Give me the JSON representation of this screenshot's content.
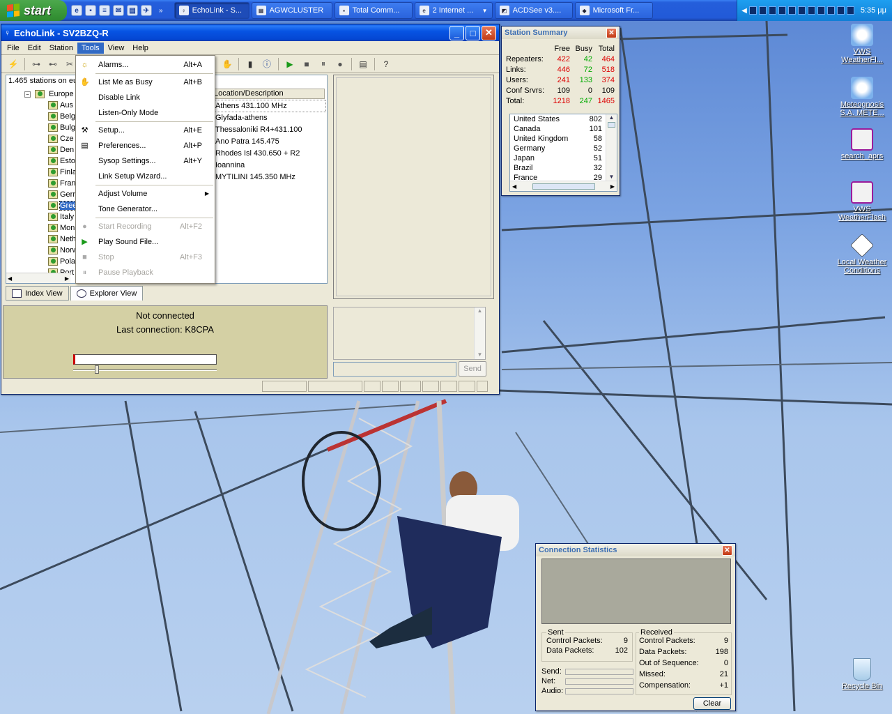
{
  "taskbar": {
    "start_label": "start",
    "tasks": [
      {
        "label": "EchoLink - S..."
      },
      {
        "label": "AGWCLUSTER"
      },
      {
        "label": "Total Comm..."
      },
      {
        "label": "2 Internet ..."
      },
      {
        "label": "ACDSee v3...."
      },
      {
        "label": "Microsoft Fr..."
      }
    ],
    "clock": "5:35 μμ"
  },
  "echolink": {
    "title": "EchoLink - SV2BZQ-R",
    "menu": [
      "File",
      "Edit",
      "Station",
      "Tools",
      "View",
      "Help"
    ],
    "tree_header": "1.465 stations on eu",
    "tree_root": "Europe",
    "tree_items": [
      "Aus",
      "Belg",
      "Bulg",
      "Cze",
      "Den",
      "Esto",
      "Finla",
      "Fran",
      "Gerr",
      "Gree",
      "Italy",
      "Mon",
      "Neth",
      "Norw",
      "Pola",
      "Port"
    ],
    "column_header": "Location/Description",
    "rows": [
      "Athens 431.100 MHz",
      "Glyfada-athens",
      "Thessaloniki R4+431.100",
      "Ano Patra 145.475",
      "Rhodes Isl 430.650 + R2",
      "Ioannina",
      "MYTILINI 145.350 MHz"
    ],
    "tabs": {
      "index": "Index View",
      "explorer": "Explorer View"
    },
    "status_line1": "Not connected",
    "status_line2": "Last connection: K8CPA",
    "send_label": "Send"
  },
  "tools_menu": {
    "items": [
      {
        "label": "Alarms...",
        "shortcut": "Alt+A",
        "icon": "alarm-icon",
        "enabled": true
      },
      {
        "label": "List Me as Busy",
        "shortcut": "Alt+B",
        "icon": "hand-icon",
        "enabled": true
      },
      {
        "label": "Disable Link",
        "shortcut": "",
        "icon": "",
        "enabled": true
      },
      {
        "label": "Listen-Only Mode",
        "shortcut": "",
        "icon": "",
        "enabled": true
      },
      {
        "label": "Setup...",
        "shortcut": "Alt+E",
        "icon": "tools-icon",
        "enabled": true
      },
      {
        "label": "Preferences...",
        "shortcut": "Alt+P",
        "icon": "preferences-icon",
        "enabled": true
      },
      {
        "label": "Sysop Settings...",
        "shortcut": "Alt+Y",
        "icon": "",
        "enabled": true
      },
      {
        "label": "Link Setup Wizard...",
        "shortcut": "",
        "icon": "",
        "enabled": true
      },
      {
        "label": "Adjust Volume",
        "shortcut": "",
        "icon": "",
        "enabled": true
      },
      {
        "label": "Tone Generator...",
        "shortcut": "",
        "icon": "",
        "enabled": true
      },
      {
        "label": "Start Recording",
        "shortcut": "Alt+F2",
        "icon": "record-icon",
        "enabled": false
      },
      {
        "label": "Play Sound File...",
        "shortcut": "",
        "icon": "play-icon",
        "enabled": true
      },
      {
        "label": "Stop",
        "shortcut": "Alt+F3",
        "icon": "stop-icon",
        "enabled": false
      },
      {
        "label": "Pause Playback",
        "shortcut": "",
        "icon": "pause-icon",
        "enabled": false
      }
    ]
  },
  "station_summary": {
    "title": "Station Summary",
    "headers": [
      "Free",
      "Busy",
      "Total"
    ],
    "rows": [
      {
        "label": "Repeaters:",
        "free": "422",
        "busy": "42",
        "total": "464"
      },
      {
        "label": "Links:",
        "free": "446",
        "busy": "72",
        "total": "518"
      },
      {
        "label": "Users:",
        "free": "241",
        "busy": "133",
        "total": "374"
      },
      {
        "label": "Conf Srvrs:",
        "free": "109",
        "busy": "0",
        "total": "109"
      },
      {
        "label": "Total:",
        "free": "1218",
        "busy": "247",
        "total": "1465"
      }
    ],
    "countries": [
      {
        "name": "United States",
        "count": "802"
      },
      {
        "name": "Canada",
        "count": "101"
      },
      {
        "name": "United Kingdom",
        "count": "58"
      },
      {
        "name": "Germany",
        "count": "52"
      },
      {
        "name": "Japan",
        "count": "51"
      },
      {
        "name": "Brazil",
        "count": "32"
      },
      {
        "name": "France",
        "count": "29"
      }
    ]
  },
  "connection_stats": {
    "title": "Connection Statistics",
    "sent_title": "Sent",
    "sent": [
      {
        "label": "Control Packets:",
        "value": "9"
      },
      {
        "label": "Data Packets:",
        "value": "102"
      }
    ],
    "received_title": "Received",
    "received": [
      {
        "label": "Control Packets:",
        "value": "9"
      },
      {
        "label": "Data Packets:",
        "value": "198"
      },
      {
        "label": "Out of Sequence:",
        "value": "0"
      },
      {
        "label": "Missed:",
        "value": "21"
      },
      {
        "label": "Compensation:",
        "value": "+1"
      }
    ],
    "meters": [
      "Send:",
      "Net:",
      "Audio:"
    ],
    "clear_label": "Clear"
  },
  "desktop_icons": [
    {
      "label": "VWS WeatherFl..."
    },
    {
      "label": "Meteognosis S.A. METE..."
    },
    {
      "label": "search_aprs"
    },
    {
      "label": "VWS WeatherFlash"
    },
    {
      "label": "Local Weather Conditions"
    },
    {
      "label": "Recycle Bin"
    }
  ]
}
